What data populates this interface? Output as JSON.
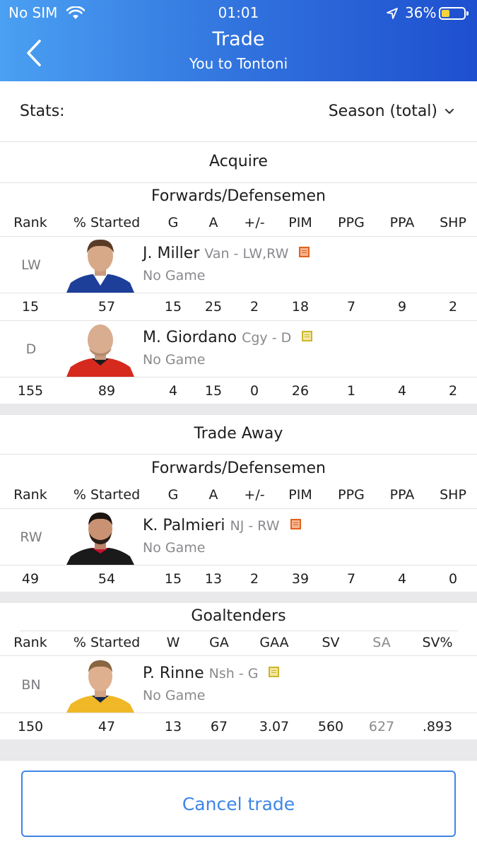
{
  "status_bar": {
    "carrier": "No SIM",
    "time": "01:01",
    "battery": "36%",
    "battery_level": 0.36
  },
  "header": {
    "title": "Trade",
    "subtitle": "You to Tontoni"
  },
  "stats": {
    "label": "Stats:",
    "selected": "Season (total)"
  },
  "colors": {
    "accent": "#3d86e6",
    "header_start": "#4aa0f2",
    "header_end": "#1e4fcf",
    "note_orange": "#e0631f",
    "note_yellow": "#cbb62c"
  },
  "acquire": {
    "title": "Acquire",
    "group": "Forwards/Defensemen",
    "columns": [
      "Rank",
      "% Started",
      "G",
      "A",
      "+/-",
      "PIM",
      "PPG",
      "PPA",
      "SHP"
    ],
    "players": [
      {
        "pos": "LW",
        "name": "J. Miller",
        "team": "Van - LW,RW",
        "status": "No Game",
        "note_icon": "note-orange-icon",
        "stats": [
          "15",
          "57",
          "15",
          "25",
          "2",
          "18",
          "7",
          "9",
          "2"
        ]
      },
      {
        "pos": "D",
        "name": "M. Giordano",
        "team": "Cgy - D",
        "status": "No Game",
        "note_icon": "note-yellow-icon",
        "stats": [
          "155",
          "89",
          "4",
          "15",
          "0",
          "26",
          "1",
          "4",
          "2"
        ]
      }
    ]
  },
  "trade_away": {
    "title": "Trade Away",
    "group": "Forwards/Defensemen",
    "columns": [
      "Rank",
      "% Started",
      "G",
      "A",
      "+/-",
      "PIM",
      "PPG",
      "PPA",
      "SHP"
    ],
    "players": [
      {
        "pos": "RW",
        "name": "K. Palmieri",
        "team": "NJ - RW",
        "status": "No Game",
        "note_icon": "note-orange-icon",
        "stats": [
          "49",
          "54",
          "15",
          "13",
          "2",
          "39",
          "7",
          "4",
          "0"
        ]
      }
    ],
    "goalie_group": "Goaltenders",
    "goalie_columns": [
      "Rank",
      "% Started",
      "W",
      "GA",
      "GAA",
      "SV",
      "SA",
      "SV%"
    ],
    "goalies": [
      {
        "pos": "BN",
        "name": "P. Rinne",
        "team": "Nsh - G",
        "status": "No Game",
        "note_icon": "note-yellow-icon",
        "stats": [
          "150",
          "47",
          "13",
          "67",
          "3.07",
          "560",
          "627",
          ".893"
        ]
      }
    ]
  },
  "cancel_label": "Cancel trade"
}
